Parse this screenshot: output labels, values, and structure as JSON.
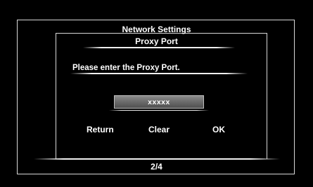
{
  "dialog": {
    "title": "Network Settings",
    "subtitle": "Proxy Port",
    "prompt": "Please enter the Proxy Port.",
    "input_value": "xxxxx",
    "buttons": {
      "return_label": "Return",
      "clear_label": "Clear",
      "ok_label": "OK"
    },
    "page_indicator": "2/4"
  }
}
